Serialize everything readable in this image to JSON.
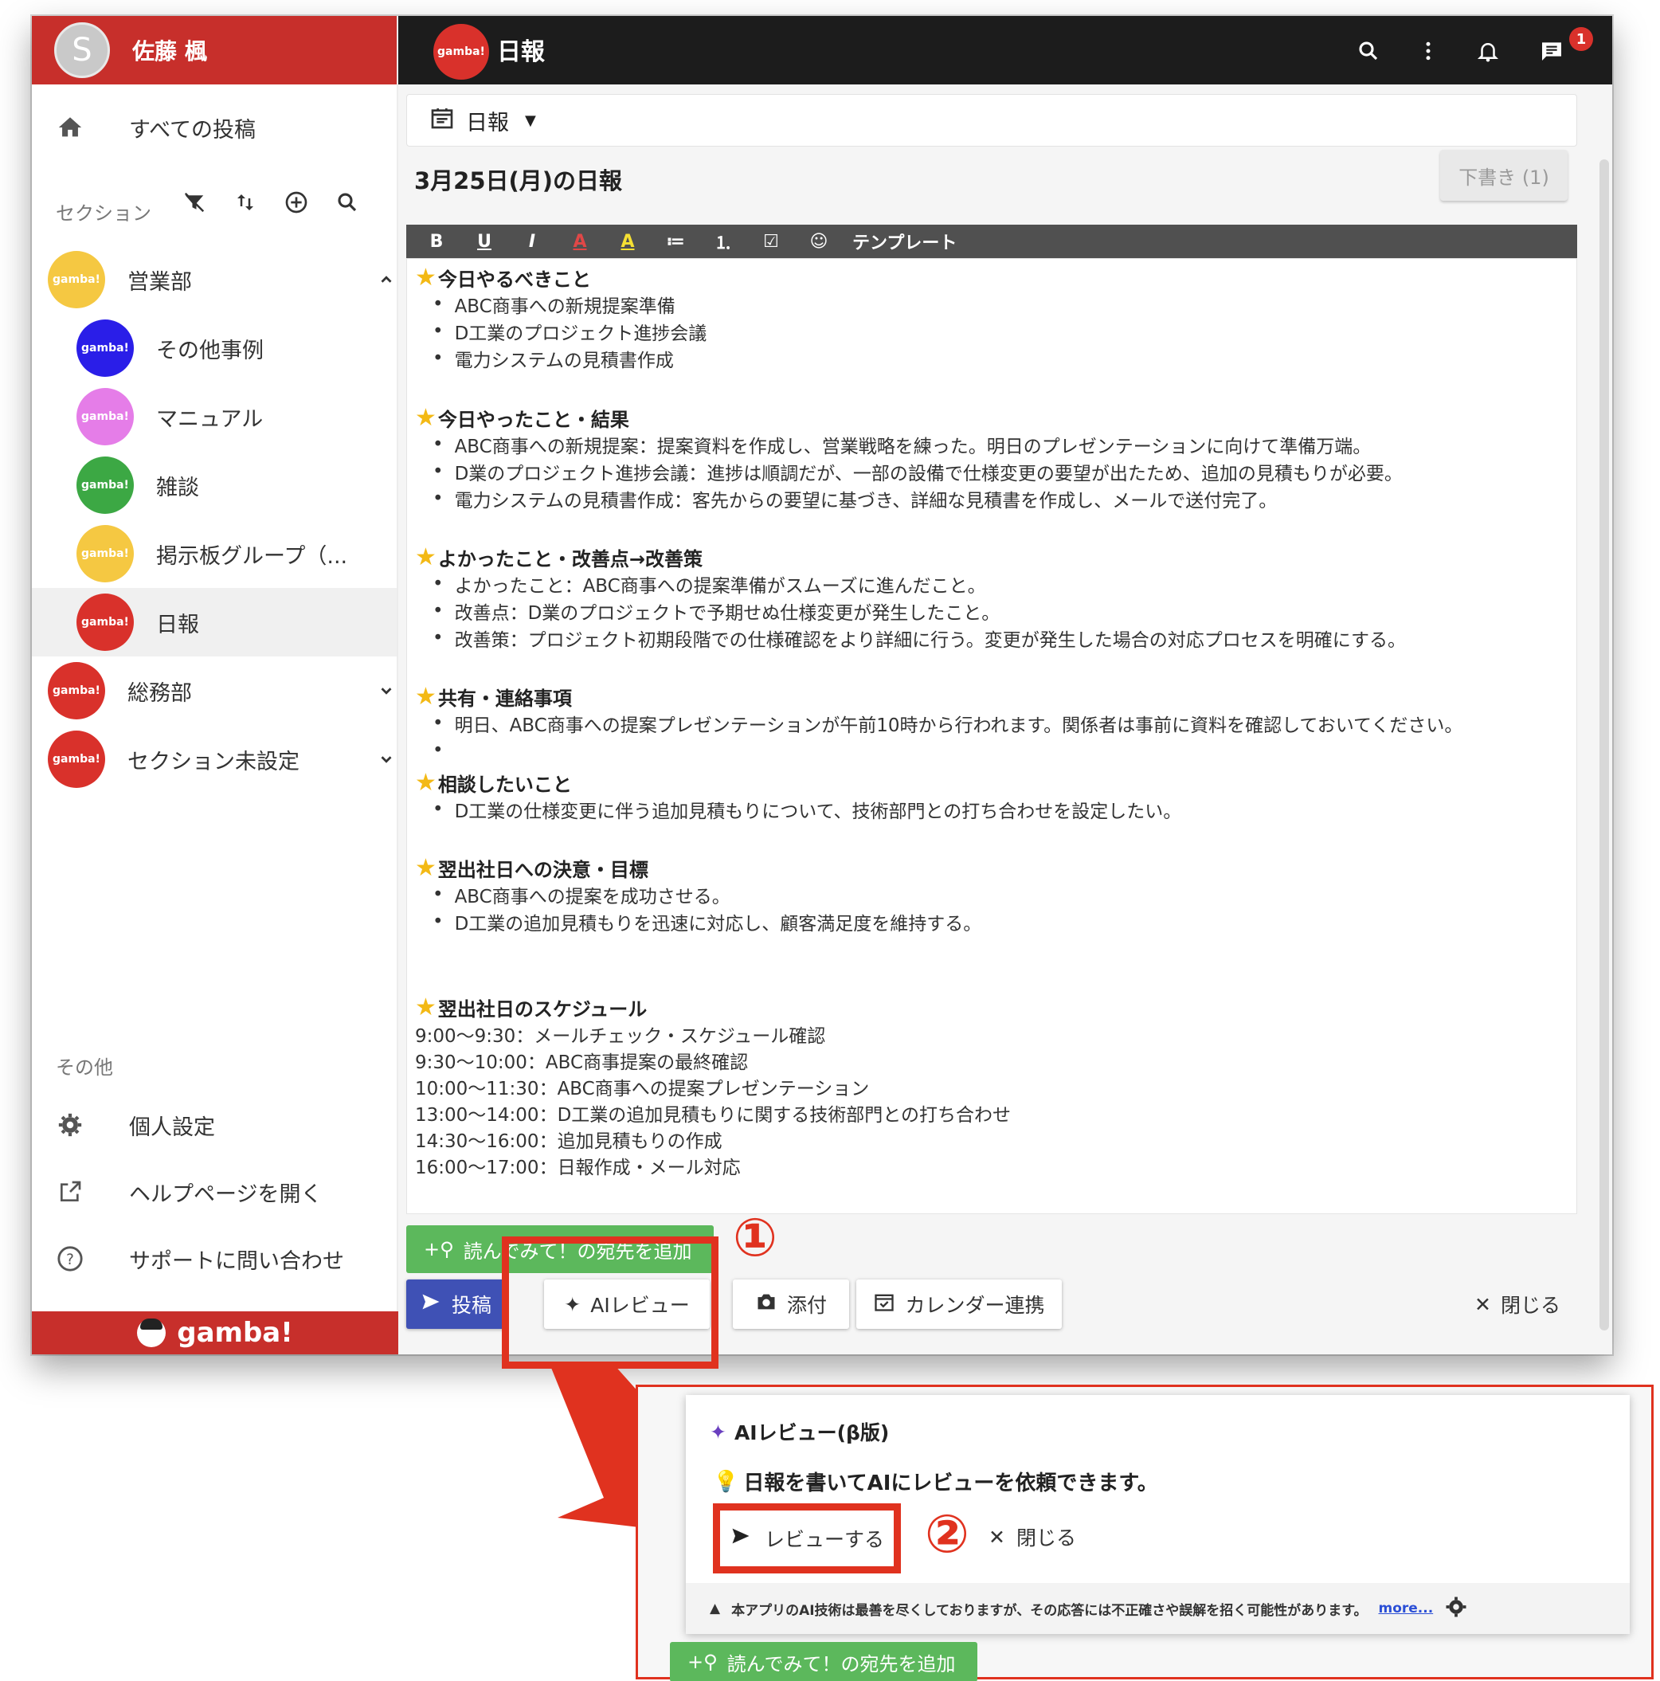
{
  "user": {
    "initial": "S",
    "name": "佐藤 楓"
  },
  "sidebar": {
    "all_posts": "すべての投稿",
    "sections_title": "セクション",
    "groups": [
      {
        "label": "営業部",
        "chip": "gamba!",
        "color": "#f5c842"
      },
      {
        "label": "その他事例",
        "chip": "gamba!",
        "color": "#2a1ee8"
      },
      {
        "label": "マニュアル",
        "chip": "gamba!",
        "color": "#e57de8"
      },
      {
        "label": "雑談",
        "chip": "gamba!",
        "color": "#3ca844"
      },
      {
        "label": "掲示板グループ（...",
        "chip": "gamba!",
        "color": "#f5c842"
      },
      {
        "label": "日報",
        "chip": "gamba!",
        "color": "#d9312b"
      },
      {
        "label": "総務部",
        "chip": "gamba!",
        "color": "#d9312b"
      },
      {
        "label": "セクション未設定",
        "chip": "gamba!",
        "color": "#d9312b"
      }
    ],
    "other_title": "その他",
    "settings": "個人設定",
    "help": "ヘルプページを開く",
    "support": "サポートに問い合わせ",
    "footer": "gamba!"
  },
  "topbar": {
    "logo": "gamba!",
    "title": "日報",
    "badge": "1"
  },
  "editor": {
    "selector": "日報",
    "post_title": "3月25日(月)の日報",
    "draft": "下書き (1)",
    "toolbar": [
      "B",
      "U",
      "I",
      "A",
      "A",
      "≔",
      "⒈",
      "☑",
      "☺",
      "テンプレート"
    ],
    "sections": [
      {
        "heading": "今日やるべきこと",
        "items": [
          "ABC商事への新規提案準備",
          "D工業のプロジェクト進捗会議",
          "電力システムの見積書作成"
        ]
      },
      {
        "heading": "今日やったこと・結果",
        "items": [
          "ABC商事への新規提案：提案資料を作成し、営業戦略を練った。明日のプレゼンテーションに向けて準備万端。",
          "D業のプロジェクト進捗会議：進捗は順調だが、一部の設備で仕様変更の要望が出たため、追加の見積もりが必要。",
          "電力システムの見積書作成：客先からの要望に基づき、詳細な見積書を作成し、メールで送付完了。"
        ]
      },
      {
        "heading": "よかったこと・改善点→改善策",
        "items": [
          "よかったこと：ABC商事への提案準備がスムーズに進んだこと。",
          "改善点：D業のプロジェクトで予期せぬ仕様変更が発生したこと。",
          "改善策：プロジェクト初期段階での仕様確認をより詳細に行う。変更が発生した場合の対応プロセスを明確にする。"
        ]
      },
      {
        "heading": "共有・連絡事項",
        "items": [
          "明日、ABC商事への提案プレゼンテーションが午前10時から行われます。関係者は事前に資料を確認しておいてください。",
          ""
        ]
      },
      {
        "heading": "相談したいこと",
        "items": [
          "D工業の仕様変更に伴う追加見積もりについて、技術部門との打ち合わせを設定したい。"
        ]
      },
      {
        "heading": "翌出社日への決意・目標",
        "items": [
          "ABC商事への提案を成功させる。",
          "D工業の追加見積もりを迅速に対応し、顧客満足度を維持する。"
        ]
      }
    ],
    "schedule_heading": "翌出社日のスケジュール",
    "schedule": [
      "9:00〜9:30：メールチェック・スケジュール確認",
      "9:30〜10:00：ABC商事提案の最終確認",
      "10:00〜11:30：ABC商事への提案プレゼンテーション",
      "13:00〜14:00：D工業の追加見積もりに関する技術部門との打ち合わせ",
      "14:30〜16:00：追加見積もりの作成",
      "16:00〜17:00：日報作成・メール対応"
    ],
    "add_reader": "読んでみて！の宛先を追加",
    "post": "投稿",
    "ai_review": "AIレビュー",
    "attach": "添付",
    "calendar": "カレンダー連携",
    "close": "閉じる"
  },
  "annotations": {
    "one": "①",
    "two": "②"
  },
  "popup": {
    "title": "AIレビュー(β版)",
    "message": "日報を書いてAIにレビューを依頼できます。",
    "review": "レビューする",
    "close": "閉じる",
    "disclaimer": "本アプリのAI技術は最善を尽くしておりますが、その応答には不正確さや誤解を招く可能性があります。",
    "more": "more...",
    "add_reader": "読んでみて！の宛先を追加"
  },
  "colors": {
    "brand_red": "#c72f2b",
    "post_blue": "#3f51b5",
    "green": "#5cb85c",
    "annotation": "#e0321f"
  }
}
